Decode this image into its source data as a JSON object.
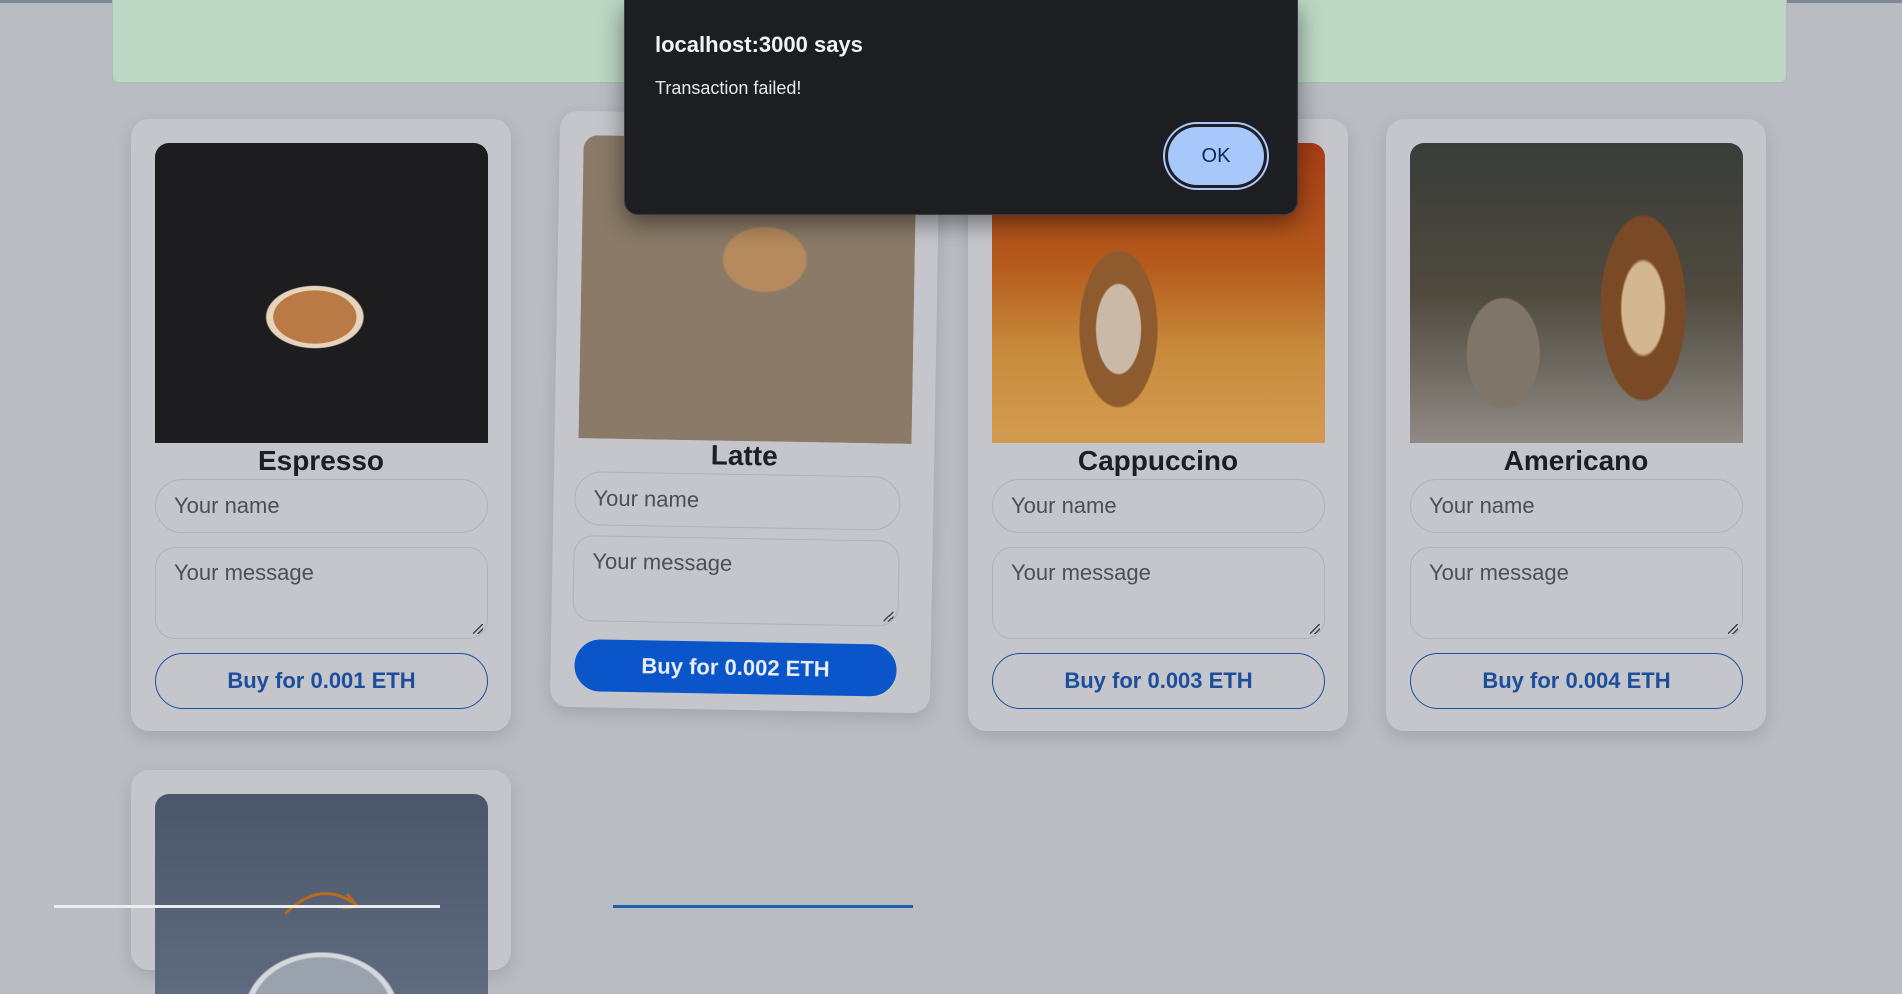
{
  "products": [
    {
      "name": "Espresso",
      "name_placeholder": "Your name",
      "message_placeholder": "Your message",
      "buy_label": "Buy for 0.001 ETH"
    },
    {
      "name": "Latte",
      "name_placeholder": "Your name",
      "message_placeholder": "Your message",
      "buy_label": "Buy for 0.002 ETH"
    },
    {
      "name": "Cappuccino",
      "name_placeholder": "Your name",
      "message_placeholder": "Your message",
      "buy_label": "Buy for 0.003 ETH"
    },
    {
      "name": "Americano",
      "name_placeholder": "Your name",
      "message_placeholder": "Your message",
      "buy_label": "Buy for 0.004 ETH"
    }
  ],
  "dialog": {
    "title": "localhost:3000 says",
    "message": "Transaction failed!",
    "ok_label": "OK"
  },
  "colors": {
    "accent": "#0a55c9",
    "dialog_bg": "#1c1e22",
    "ok_button": "#a8c7fa"
  }
}
